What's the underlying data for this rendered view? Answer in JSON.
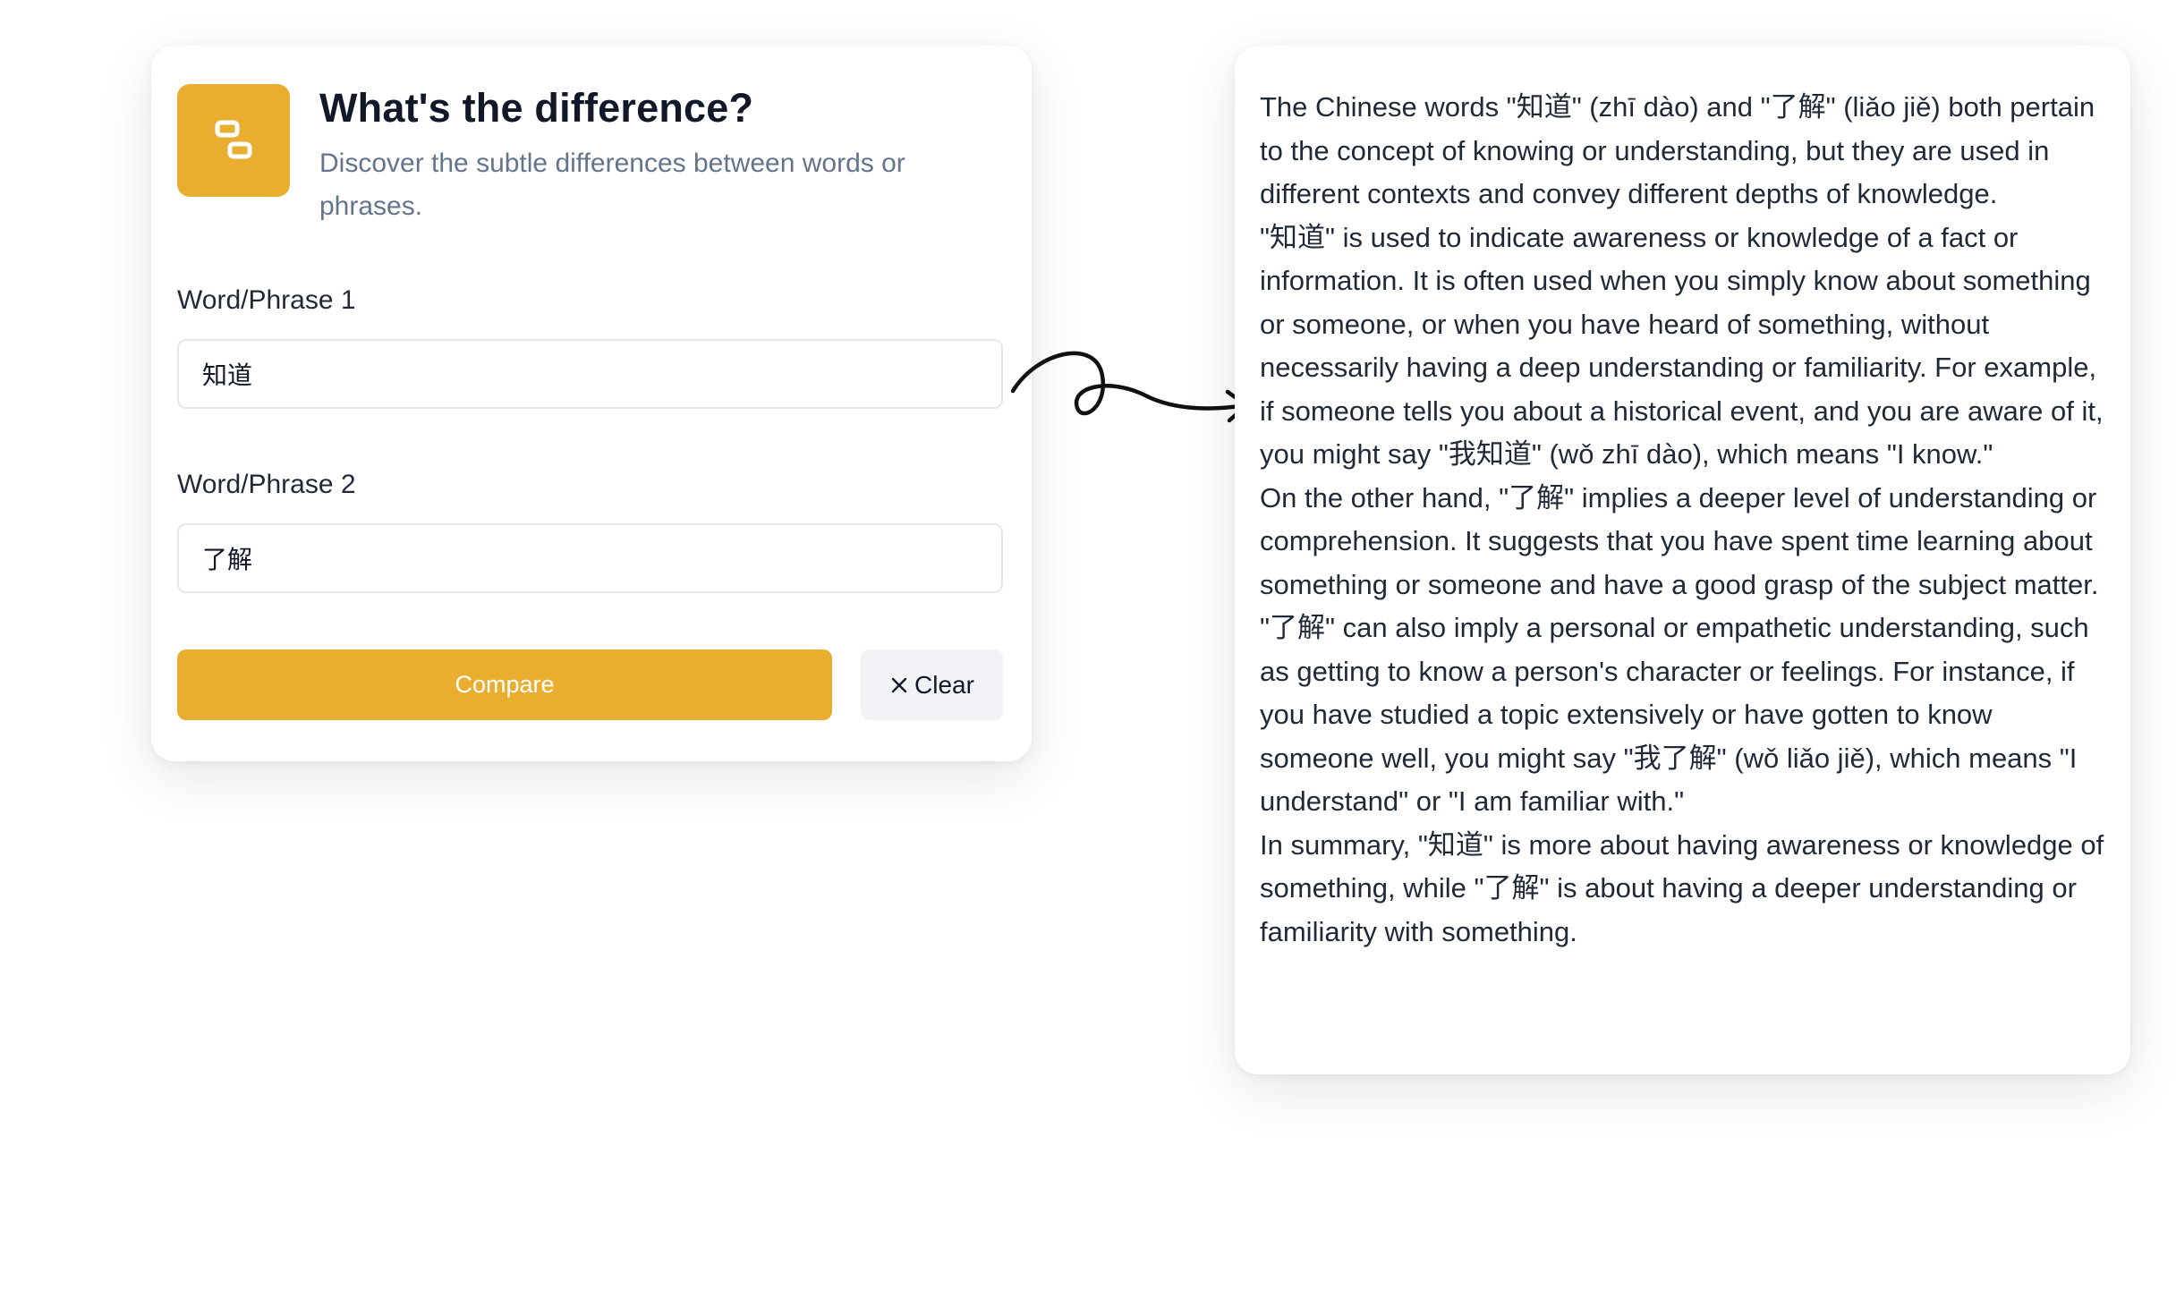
{
  "app": {
    "title": "What's the difference?",
    "subtitle": "Discover the subtle differences between words or phrases.",
    "logo_icon": "compare-blocks-icon",
    "accent_color": "#e9ae2f"
  },
  "form": {
    "field1": {
      "label": "Word/Phrase 1",
      "value": "知道"
    },
    "field2": {
      "label": "Word/Phrase 2",
      "value": "了解"
    },
    "compare_label": "Compare",
    "clear_label": "Clear",
    "clear_icon": "close-icon"
  },
  "result": {
    "paragraphs": [
      "The Chinese words \"知道\" (zhī dào) and \"了解\" (liǎo jiě) both pertain to the concept of knowing or understanding, but they are used in different contexts and convey different depths of knowledge.",
      "\"知道\" is used to indicate awareness or knowledge of a fact or information. It is often used when you simply know about something or someone, or when you have heard of something, without necessarily having a deep understanding or familiarity. For example, if someone tells you about a historical event, and you are aware of it, you might say \"我知道\" (wǒ zhī dào), which means \"I know.\"",
      "On the other hand, \"了解\" implies a deeper level of understanding or comprehension. It suggests that you have spent time learning about something or someone and have a good grasp of the subject matter. \"了解\" can also imply a personal or empathetic understanding, such as getting to know a person's character or feelings. For instance, if you have studied a topic extensively or have gotten to know someone well, you might say \"我了解\" (wǒ liǎo jiě), which means \"I understand\" or \"I am familiar with.\"",
      "In summary, \"知道\" is more about having awareness or knowledge of something, while \"了解\" is about having a deeper understanding or familiarity with something."
    ]
  },
  "decoration": {
    "arrow_icon": "curly-arrow-icon"
  }
}
